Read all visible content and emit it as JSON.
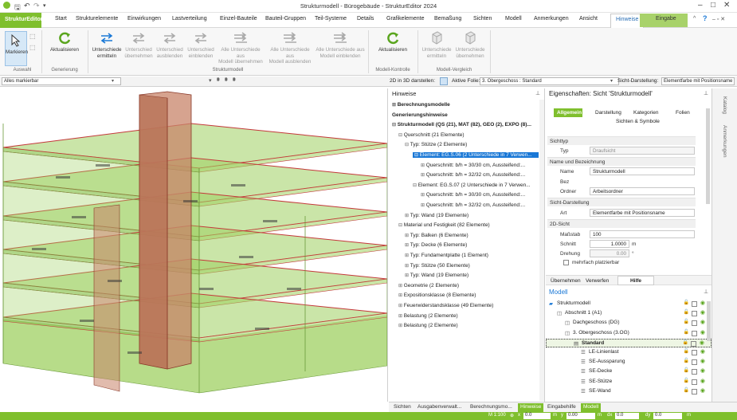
{
  "window": {
    "title": "Strukturmodell - Bürogebäude - StrukturEditor 2024",
    "controls": [
      "minimize-icon",
      "maximize-icon",
      "close-icon"
    ]
  },
  "tabs": {
    "file": "StrukturEditor",
    "items": [
      "Start",
      "Strukturelemente",
      "Einwirkungen",
      "Lastverteilung",
      "Einzel-Bauteile",
      "Bauteil-Gruppen",
      "Teil-Systeme",
      "Details",
      "Grafikelemente",
      "Bemaßung",
      "Sichten",
      "Modell",
      "Anmerkungen",
      "Ansicht"
    ],
    "active": "Hinweise",
    "eingabe": "Eingabe"
  },
  "ribbon": {
    "auswahl": {
      "label": "Auswahl",
      "markieren": "Markieren"
    },
    "generierung": {
      "label": "Generierung",
      "aktualisieren": "Aktualisieren"
    },
    "strukturmodell": {
      "label": "Strukturmodell",
      "buttons": [
        {
          "l1": "Unterschiede",
          "l2": "ermitteln"
        },
        {
          "l1": "Unterschied",
          "l2": "übernehmen"
        },
        {
          "l1": "Unterschied",
          "l2": "ausblenden"
        },
        {
          "l1": "Unterschied",
          "l2": "einblenden"
        },
        {
          "l1": "Alle Unterschiede aus",
          "l2": "Modell übernehmen"
        },
        {
          "l1": "Alle Unterschiede aus",
          "l2": "Modell ausblenden"
        },
        {
          "l1": "Alle Unterschiede aus",
          "l2": "Modell einblenden"
        }
      ]
    },
    "modellkontrolle": {
      "label": "Modell-Kontrolle",
      "aktualisieren": "Aktualisieren"
    },
    "modellvergleich": {
      "label": "Modell-Vergleich",
      "buttons": [
        {
          "l1": "Unterschiede",
          "l2": "ermitteln"
        },
        {
          "l1": "Unterschiede",
          "l2": "übernehmen"
        }
      ]
    }
  },
  "optbar": {
    "select_all": "Alles markierbar",
    "view2d3d_label": "2D in 3D darstellen:",
    "active_sheet_label": "Aktive Folie:",
    "active_sheet": "3. Obergeschoss : Standard",
    "view_display_label": "Sicht-Darstellung:",
    "view_display": "Elementfarbe mit Positionsname"
  },
  "hinweise": {
    "title": "Hinweise",
    "items": [
      {
        "text": "Berechnungsmodelle",
        "bold": true,
        "tw": "⊞"
      },
      {
        "text": "Generierungshinweise",
        "bold": true,
        "tw": ""
      },
      {
        "text": "Strukturmodell (QS (21), MAT (82), GEO (2), EXPO (8)...",
        "bold": true,
        "tw": "⊟"
      },
      {
        "text": "Querschnitt (21 Elemente)",
        "bold": false,
        "tw": "⊟"
      },
      {
        "text": "Typ: Stütze (2 Elemente)",
        "bold": false,
        "tw": "⊟"
      },
      {
        "text": "Element: EG.S.06 (2 Unterschiede in 7 Verwen...",
        "bold": false,
        "tw": "⊟",
        "selected": true
      },
      {
        "text": "Querschnitt: b/h = 30/30 cm, Aussteifend:...",
        "bold": false,
        "tw": "⊞"
      },
      {
        "text": "Querschnitt: b/h = 32/32 cm, Aussteifend:...",
        "bold": false,
        "tw": "⊞"
      },
      {
        "text": "Element: EG.S.07 (2 Unterschiede in 7 Verwen...",
        "bold": false,
        "tw": "⊟"
      },
      {
        "text": "Querschnitt: b/h = 30/30 cm, Aussteifend:...",
        "bold": false,
        "tw": "⊞"
      },
      {
        "text": "Querschnitt: b/h = 32/32 cm, Aussteifend:...",
        "bold": false,
        "tw": "⊞"
      },
      {
        "text": "Typ: Wand (19 Elemente)",
        "bold": false,
        "tw": "⊞"
      },
      {
        "text": "Material und Festigkeit (82 Elemente)",
        "bold": false,
        "tw": "⊟"
      },
      {
        "text": "Typ: Balken (6 Elemente)",
        "bold": false,
        "tw": "⊞"
      },
      {
        "text": "Typ: Decke (6 Elemente)",
        "bold": false,
        "tw": "⊞"
      },
      {
        "text": "Typ: Fundamentplatte (1 Element)",
        "bold": false,
        "tw": "⊞"
      },
      {
        "text": "Typ: Stütze (50 Elemente)",
        "bold": false,
        "tw": "⊞"
      },
      {
        "text": "Typ: Wand (19 Elemente)",
        "bold": false,
        "tw": "⊞"
      },
      {
        "text": "Geometrie (2 Elemente)",
        "bold": false,
        "tw": "⊞"
      },
      {
        "text": "Expositionsklasse (8 Elemente)",
        "bold": false,
        "tw": "⊞"
      },
      {
        "text": "Feuerwiderstandsklasse (49 Elemente)",
        "bold": false,
        "tw": "⊞"
      },
      {
        "text": "Belastung (2 Elemente)",
        "bold": false,
        "tw": "⊞"
      },
      {
        "text": "Belastung (2 Elemente)",
        "bold": false,
        "tw": "⊞"
      }
    ]
  },
  "props": {
    "title": "Eigenschaften: Sicht 'Strukturmodell'",
    "tabs": [
      "Allgemein",
      "Darstellung",
      "Kategorien",
      "Folien"
    ],
    "tab2": "Sichten & Symbole",
    "sections": {
      "sichttyp": "Sichttyp",
      "name": "Name und Bezeichnung",
      "darst": "Sicht-Darstellung",
      "sicht2d": "2D-Sicht"
    },
    "fields": {
      "typ_label": "Typ",
      "typ": "Draufsicht",
      "name_label": "Name",
      "name": "Strukturmodell",
      "bez_label": "Bez",
      "ordner_label": "Ordner",
      "ordner": "Arbeitsordner",
      "art_label": "Art",
      "art": "Elementfarbe mit Positionsname",
      "massstab_label": "Maßstab",
      "massstab": "100",
      "schnitt_label": "Schnitt",
      "schnitt": "1.0000",
      "schnitt_unit": "m",
      "drehung_label": "Drehung",
      "drehung": "0.00",
      "drehung_unit": "°",
      "mehrfach": "mehrfach platzierbar"
    },
    "buttons": [
      "Übernehmen",
      "Verwerfen",
      "Hilfe"
    ]
  },
  "modell": {
    "title": "Modell",
    "rows": [
      {
        "text": "Strukturmodell",
        "indent": 0,
        "bold": false
      },
      {
        "text": "Abschnitt 1 (A1)",
        "indent": 1,
        "bold": false
      },
      {
        "text": "Dachgeschoss (DG)",
        "indent": 2,
        "bold": false
      },
      {
        "text": "3. Obergeschoss (3.OG)",
        "indent": 2,
        "bold": false
      },
      {
        "text": "Standard",
        "indent": 3,
        "bold": true
      },
      {
        "text": "LE-Linienlast",
        "indent": 4,
        "bold": false
      },
      {
        "text": "SE-Aussparung",
        "indent": 4,
        "bold": false
      },
      {
        "text": "SE-Decke",
        "indent": 4,
        "bold": false
      },
      {
        "text": "SE-Stütze",
        "indent": 4,
        "bold": false
      },
      {
        "text": "SE-Wand",
        "indent": 4,
        "bold": false
      }
    ]
  },
  "sidetabs": [
    "Katalog",
    "Anmerkungen"
  ],
  "bottomtabs": [
    "Sichten",
    "Ausgabenverwalt...",
    "Berechnungsmo...",
    "Hinweise",
    "Eingabehilfe",
    "Modell"
  ],
  "statusbar": {
    "scale": "M 1:100",
    "x_label": "x",
    "x": "0.0",
    "x_unit": "m",
    "y_label": "y",
    "y": "0.00",
    "y_unit": "m",
    "dx_label": "dx",
    "dx": "0.0",
    "dy_label": "dy",
    "dy": "0.0",
    "dy_unit": "m"
  },
  "colors": {
    "accent": "#7fbf2d",
    "selection": "#1a78d6",
    "slab_fill": "#9fd061",
    "slab_edge": "#c4383a",
    "core_fill": "#c8846a"
  }
}
